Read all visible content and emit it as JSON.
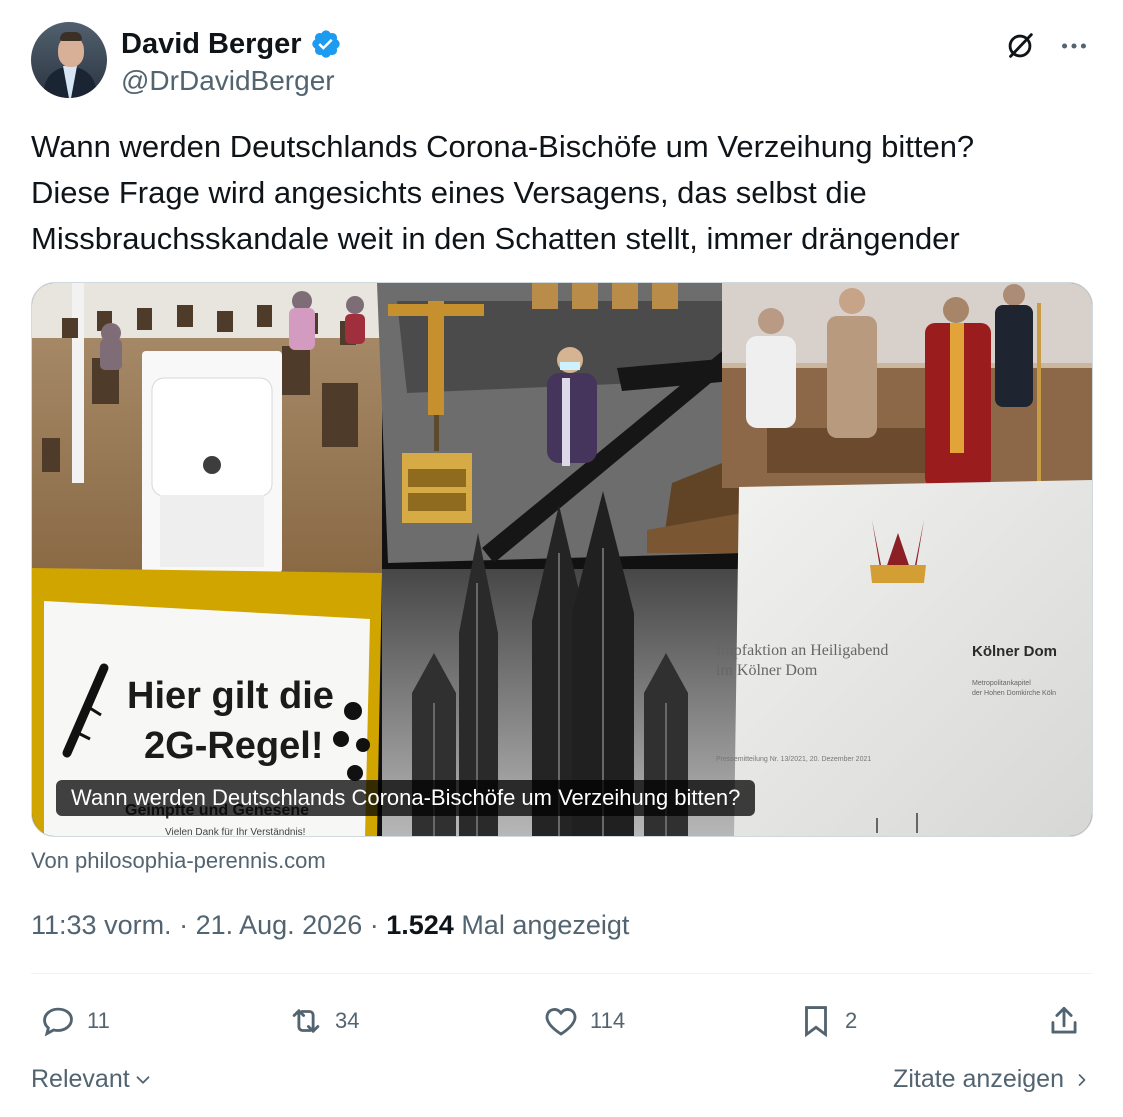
{
  "author": {
    "display_name": "David Berger",
    "handle": "@DrDavidBerger",
    "verified": true
  },
  "icons": {
    "verified": "verified-badge-icon",
    "grok": "grok-icon",
    "more": "more-options-icon",
    "reply": "reply-icon",
    "retweet": "retweet-icon",
    "like": "heart-icon",
    "bookmark": "bookmark-icon",
    "share": "share-icon",
    "chevron_down": "chevron-down-icon",
    "chevron_right": "chevron-right-icon"
  },
  "tweet": {
    "text": "Wann werden Deutschlands Corona-Bischöfe um Verzeihung bitten?\nDiese Frage wird angesichts eines Versagens, das selbst die\nMissbrauchsskandale weit in den Schatten stellt, immer drängender"
  },
  "card": {
    "overlay_title": "Wann werden Deutschlands Corona-Bischöfe um Verzeihung bitten?",
    "source": "Von philosophia-perennis.com",
    "image_text": {
      "sign_line1": "Hier gilt die",
      "sign_line2": "2G-Regel!",
      "sign_line3": "Geimpfte und Genesene",
      "sign_line4": "Vielen Dank für Ihr Verständnis!",
      "press_title1": "Impfaktion an Heiligabend",
      "press_title2": "im Kölner Dom",
      "press_brand": "Kölner Dom",
      "press_sub1": "Metropolitankapitel",
      "press_sub2": "der Hohen Domkirche Köln",
      "press_date": "Pressemitteilung Nr. 13/2021, 20. Dezember 2021"
    }
  },
  "meta": {
    "time": "11:33 vorm.",
    "separator1": " · ",
    "date": "21. Aug. 2026",
    "separator2": " · ",
    "views": "1.524",
    "views_label": " Mal angezeigt"
  },
  "actions": {
    "replies": "11",
    "retweets": "34",
    "likes": "114",
    "bookmarks": "2"
  },
  "footer": {
    "relevance": "Relevant",
    "quotes": "Zitate anzeigen"
  },
  "colors": {
    "text": "#0f1419",
    "secondary": "#536471",
    "verified": "#1d9bf0",
    "border": "#cfd9de",
    "divider": "#eff3f4"
  }
}
